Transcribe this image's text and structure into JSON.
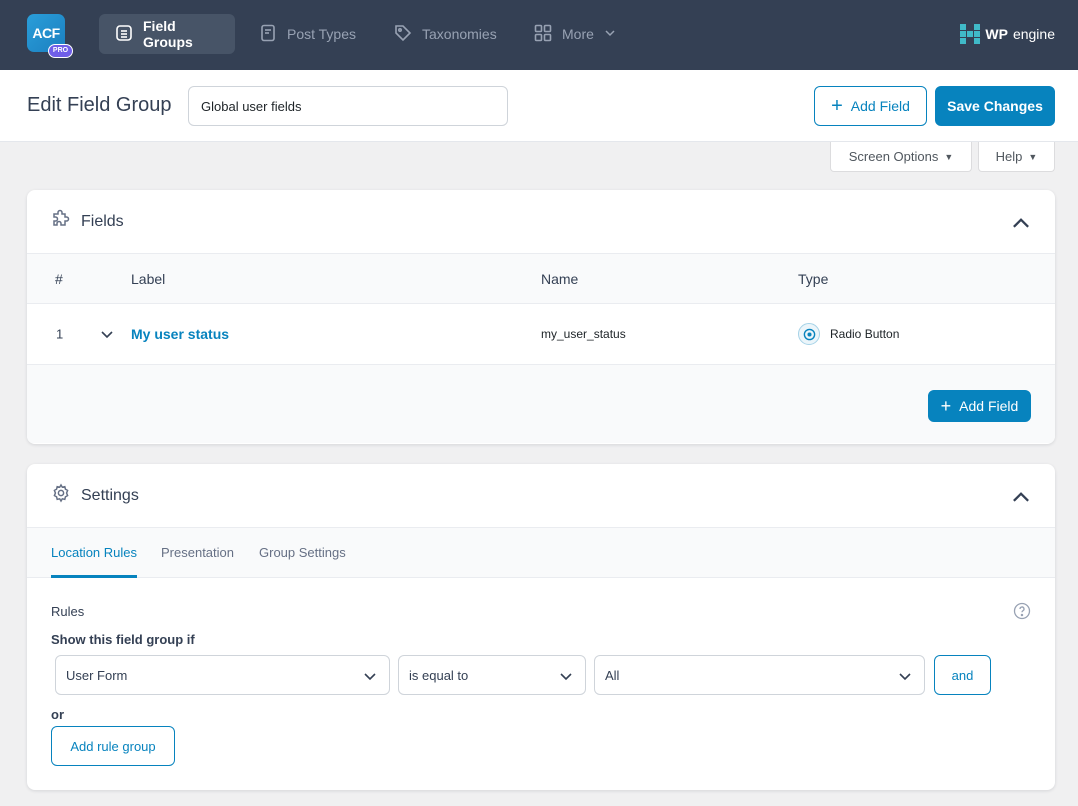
{
  "nav": {
    "logo_text": "ACF",
    "logo_badge": "PRO",
    "tabs": [
      {
        "label": "Field Groups",
        "icon": "list-icon",
        "active": true
      },
      {
        "label": "Post Types",
        "icon": "document-icon",
        "active": false
      },
      {
        "label": "Taxonomies",
        "icon": "tag-icon",
        "active": false
      },
      {
        "label": "More",
        "icon": "grid-icon",
        "active": false
      }
    ],
    "brand": {
      "bold": "WP",
      "rest": "engine"
    }
  },
  "header": {
    "title": "Edit Field Group",
    "group_title_value": "Global user fields",
    "add_field_label": "Add Field",
    "save_label": "Save Changes"
  },
  "screen_options": {
    "screen_options_label": "Screen Options",
    "help_label": "Help"
  },
  "fields_panel": {
    "title": "Fields",
    "columns": {
      "num": "#",
      "label": "Label",
      "name": "Name",
      "type": "Type"
    },
    "rows": [
      {
        "num": "1",
        "label": "My user status",
        "name": "my_user_status",
        "type": "Radio Button"
      }
    ],
    "add_field_label": "Add Field"
  },
  "settings_panel": {
    "title": "Settings",
    "tabs": [
      "Location Rules",
      "Presentation",
      "Group Settings"
    ],
    "active_tab": "Location Rules",
    "rules_label": "Rules",
    "show_if_label": "Show this field group if",
    "rule": {
      "param": "User Form",
      "operator": "is equal to",
      "value": "All"
    },
    "and_label": "and",
    "or_label": "or",
    "add_rule_group_label": "Add rule group"
  },
  "colors": {
    "accent": "#0783be",
    "nav_bg": "#344054",
    "nav_active": "#475467"
  }
}
